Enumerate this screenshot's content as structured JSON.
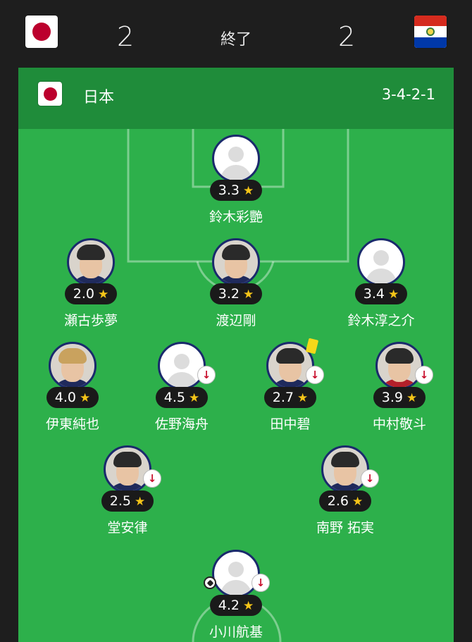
{
  "match": {
    "home_score": "2",
    "away_score": "2",
    "status": "終了",
    "home_flag_icon": "japan-flag-icon",
    "away_flag_icon": "paraguay-flag-icon"
  },
  "team": {
    "name": "日本",
    "formation": "3-4-2-1"
  },
  "players": [
    {
      "name": "鈴木彩艷",
      "rating": "3.3",
      "avatar": "placeholder"
    },
    {
      "name": "瀬古歩夢",
      "rating": "2.0",
      "avatar": "photo"
    },
    {
      "name": "渡辺剛",
      "rating": "3.2",
      "avatar": "photo"
    },
    {
      "name": "鈴木淳之介",
      "rating": "3.4",
      "avatar": "placeholder"
    },
    {
      "name": "伊東純也",
      "rating": "4.0",
      "avatar": "photo"
    },
    {
      "name": "佐野海舟",
      "rating": "4.5",
      "avatar": "placeholder",
      "substituted": true
    },
    {
      "name": "田中碧",
      "rating": "2.7",
      "avatar": "photo",
      "substituted": true,
      "yellow_card": true
    },
    {
      "name": "中村敬斗",
      "rating": "3.9",
      "avatar": "photo",
      "substituted": true
    },
    {
      "name": "堂安律",
      "rating": "2.5",
      "avatar": "photo",
      "substituted": true
    },
    {
      "name": "南野 拓実",
      "rating": "2.6",
      "avatar": "photo",
      "substituted": true
    },
    {
      "name": "小川航基",
      "rating": "4.2",
      "avatar": "placeholder",
      "substituted": true,
      "goal": true
    }
  ],
  "icons": {
    "rating_star": "★",
    "sub_arrow": "↓"
  },
  "colors": {
    "header_bg": "#1e1e1e",
    "pitch": "#2db04b",
    "team_bar": "#1f8c3a",
    "rating_bg": "#1a1a1a",
    "star": "#f5c518",
    "sub_arrow": "#c8102e",
    "yellow_card": "#f5d81a"
  }
}
